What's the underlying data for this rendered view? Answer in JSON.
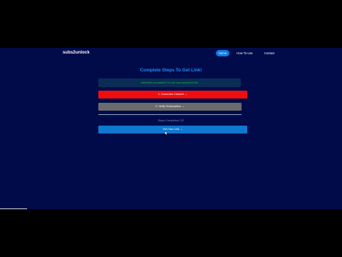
{
  "navbar": {
    "brand": "subs2unlock",
    "items": [
      {
        "label": "Home",
        "active": true
      },
      {
        "label": "How To Use"
      },
      {
        "label": "Contact"
      }
    ]
  },
  "main": {
    "title": "Complete Steps To Get Link!",
    "alert": "Verification successful! You can now access the link.",
    "steps": [
      {
        "label": "1. Subscribe Channel →",
        "color": "#ef0d10"
      },
      {
        "label": "2. Verify Subscription →",
        "color": "#6b6b6b"
      }
    ],
    "progress": "Steps Completed: 2/2",
    "progress_fraction": 1.0,
    "get_link_label": "Get Your Link →"
  },
  "colors": {
    "page_bg": "#020b4a",
    "accent": "#1d8cf8",
    "success": "#1fbf3a",
    "link_button": "#0e79cf"
  }
}
